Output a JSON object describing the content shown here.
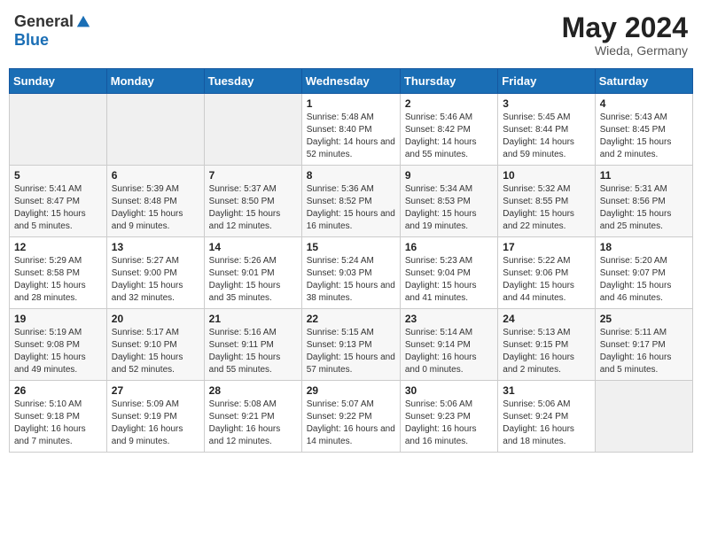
{
  "header": {
    "logo_general": "General",
    "logo_blue": "Blue",
    "month_year": "May 2024",
    "location": "Wieda, Germany"
  },
  "days_of_week": [
    "Sunday",
    "Monday",
    "Tuesday",
    "Wednesday",
    "Thursday",
    "Friday",
    "Saturday"
  ],
  "weeks": [
    [
      {
        "day": "",
        "info": ""
      },
      {
        "day": "",
        "info": ""
      },
      {
        "day": "",
        "info": ""
      },
      {
        "day": "1",
        "info": "Sunrise: 5:48 AM\nSunset: 8:40 PM\nDaylight: 14 hours\nand 52 minutes."
      },
      {
        "day": "2",
        "info": "Sunrise: 5:46 AM\nSunset: 8:42 PM\nDaylight: 14 hours\nand 55 minutes."
      },
      {
        "day": "3",
        "info": "Sunrise: 5:45 AM\nSunset: 8:44 PM\nDaylight: 14 hours\nand 59 minutes."
      },
      {
        "day": "4",
        "info": "Sunrise: 5:43 AM\nSunset: 8:45 PM\nDaylight: 15 hours\nand 2 minutes."
      }
    ],
    [
      {
        "day": "5",
        "info": "Sunrise: 5:41 AM\nSunset: 8:47 PM\nDaylight: 15 hours\nand 5 minutes."
      },
      {
        "day": "6",
        "info": "Sunrise: 5:39 AM\nSunset: 8:48 PM\nDaylight: 15 hours\nand 9 minutes."
      },
      {
        "day": "7",
        "info": "Sunrise: 5:37 AM\nSunset: 8:50 PM\nDaylight: 15 hours\nand 12 minutes."
      },
      {
        "day": "8",
        "info": "Sunrise: 5:36 AM\nSunset: 8:52 PM\nDaylight: 15 hours\nand 16 minutes."
      },
      {
        "day": "9",
        "info": "Sunrise: 5:34 AM\nSunset: 8:53 PM\nDaylight: 15 hours\nand 19 minutes."
      },
      {
        "day": "10",
        "info": "Sunrise: 5:32 AM\nSunset: 8:55 PM\nDaylight: 15 hours\nand 22 minutes."
      },
      {
        "day": "11",
        "info": "Sunrise: 5:31 AM\nSunset: 8:56 PM\nDaylight: 15 hours\nand 25 minutes."
      }
    ],
    [
      {
        "day": "12",
        "info": "Sunrise: 5:29 AM\nSunset: 8:58 PM\nDaylight: 15 hours\nand 28 minutes."
      },
      {
        "day": "13",
        "info": "Sunrise: 5:27 AM\nSunset: 9:00 PM\nDaylight: 15 hours\nand 32 minutes."
      },
      {
        "day": "14",
        "info": "Sunrise: 5:26 AM\nSunset: 9:01 PM\nDaylight: 15 hours\nand 35 minutes."
      },
      {
        "day": "15",
        "info": "Sunrise: 5:24 AM\nSunset: 9:03 PM\nDaylight: 15 hours\nand 38 minutes."
      },
      {
        "day": "16",
        "info": "Sunrise: 5:23 AM\nSunset: 9:04 PM\nDaylight: 15 hours\nand 41 minutes."
      },
      {
        "day": "17",
        "info": "Sunrise: 5:22 AM\nSunset: 9:06 PM\nDaylight: 15 hours\nand 44 minutes."
      },
      {
        "day": "18",
        "info": "Sunrise: 5:20 AM\nSunset: 9:07 PM\nDaylight: 15 hours\nand 46 minutes."
      }
    ],
    [
      {
        "day": "19",
        "info": "Sunrise: 5:19 AM\nSunset: 9:08 PM\nDaylight: 15 hours\nand 49 minutes."
      },
      {
        "day": "20",
        "info": "Sunrise: 5:17 AM\nSunset: 9:10 PM\nDaylight: 15 hours\nand 52 minutes."
      },
      {
        "day": "21",
        "info": "Sunrise: 5:16 AM\nSunset: 9:11 PM\nDaylight: 15 hours\nand 55 minutes."
      },
      {
        "day": "22",
        "info": "Sunrise: 5:15 AM\nSunset: 9:13 PM\nDaylight: 15 hours\nand 57 minutes."
      },
      {
        "day": "23",
        "info": "Sunrise: 5:14 AM\nSunset: 9:14 PM\nDaylight: 16 hours\nand 0 minutes."
      },
      {
        "day": "24",
        "info": "Sunrise: 5:13 AM\nSunset: 9:15 PM\nDaylight: 16 hours\nand 2 minutes."
      },
      {
        "day": "25",
        "info": "Sunrise: 5:11 AM\nSunset: 9:17 PM\nDaylight: 16 hours\nand 5 minutes."
      }
    ],
    [
      {
        "day": "26",
        "info": "Sunrise: 5:10 AM\nSunset: 9:18 PM\nDaylight: 16 hours\nand 7 minutes."
      },
      {
        "day": "27",
        "info": "Sunrise: 5:09 AM\nSunset: 9:19 PM\nDaylight: 16 hours\nand 9 minutes."
      },
      {
        "day": "28",
        "info": "Sunrise: 5:08 AM\nSunset: 9:21 PM\nDaylight: 16 hours\nand 12 minutes."
      },
      {
        "day": "29",
        "info": "Sunrise: 5:07 AM\nSunset: 9:22 PM\nDaylight: 16 hours\nand 14 minutes."
      },
      {
        "day": "30",
        "info": "Sunrise: 5:06 AM\nSunset: 9:23 PM\nDaylight: 16 hours\nand 16 minutes."
      },
      {
        "day": "31",
        "info": "Sunrise: 5:06 AM\nSunset: 9:24 PM\nDaylight: 16 hours\nand 18 minutes."
      },
      {
        "day": "",
        "info": ""
      }
    ]
  ]
}
